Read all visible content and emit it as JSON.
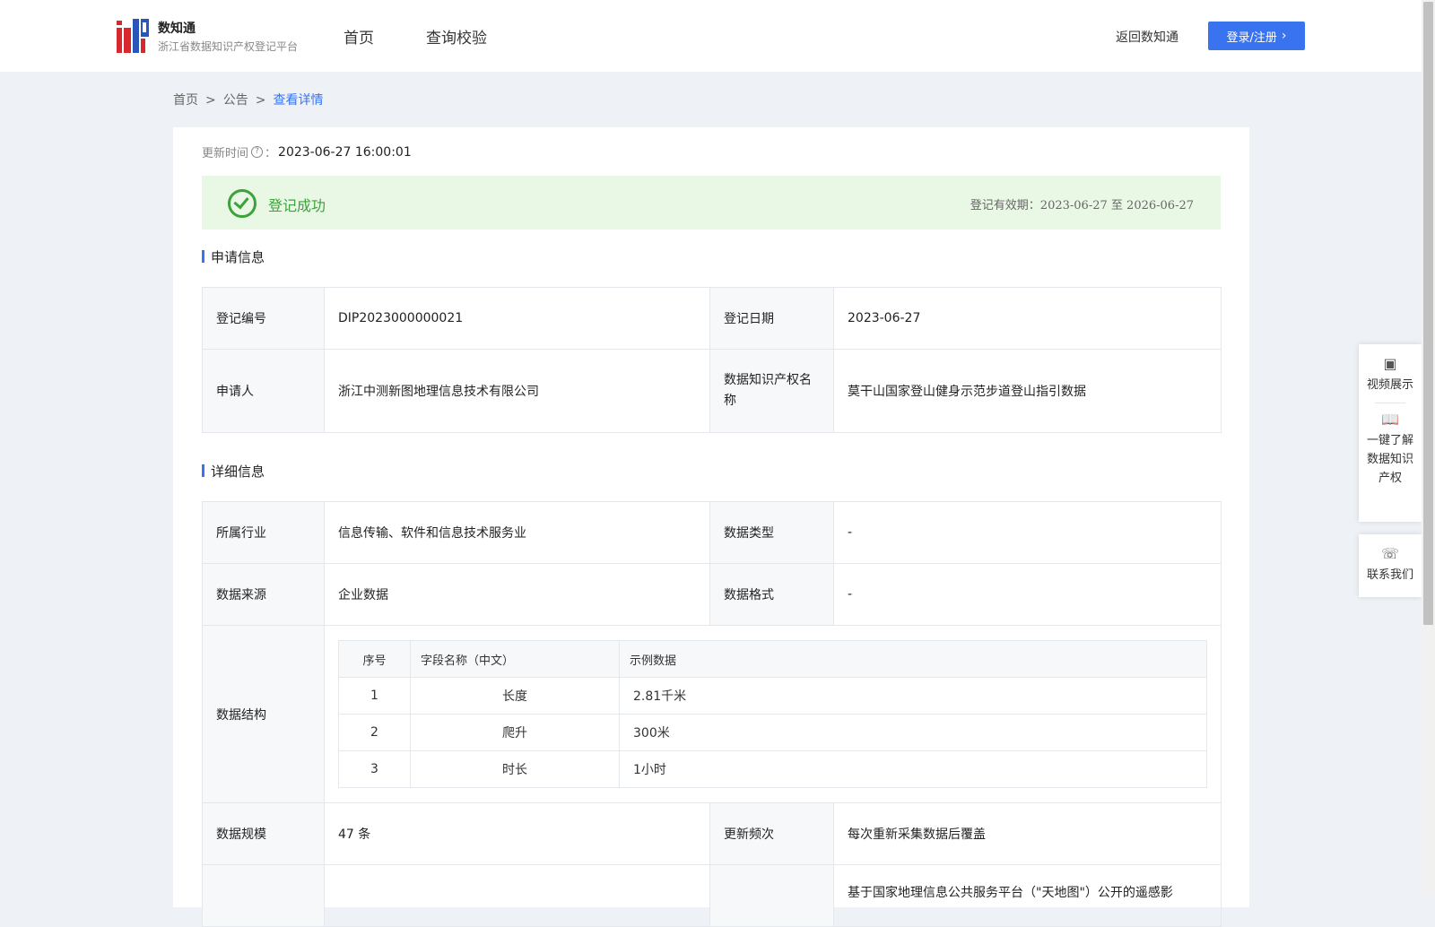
{
  "header": {
    "logo_title": "数知通",
    "logo_subtitle": "浙江省数据知识产权登记平台",
    "nav": [
      "首页",
      "查询校验"
    ],
    "back_link": "返回数知通",
    "login_button": "登录/注册"
  },
  "breadcrumb": [
    "首页",
    "公告",
    "查看详情"
  ],
  "update": {
    "label": "更新时间",
    "value": "2023-06-27 16:00:01"
  },
  "status": {
    "text": "登记成功",
    "validity_label": "登记有效期：",
    "validity_from": "2023-06-27",
    "validity_to_word": "至",
    "validity_to": "2026-06-27"
  },
  "apply_section": {
    "title": "申请信息",
    "reg_no_label": "登记编号",
    "reg_no_value": "DIP2023000000021",
    "reg_date_label": "登记日期",
    "reg_date_value": "2023-06-27",
    "applicant_label": "申请人",
    "applicant_value": "浙江中测新图地理信息技术有限公司",
    "ip_name_label": "数据知识产权名称",
    "ip_name_value": "莫干山国家登山健身示范步道登山指引数据"
  },
  "detail_section": {
    "title": "详细信息",
    "industry_label": "所属行业",
    "industry_value": "信息传输、软件和信息技术服务业",
    "data_type_label": "数据类型",
    "data_type_value": "-",
    "source_label": "数据来源",
    "source_value": "企业数据",
    "format_label": "数据格式",
    "format_value": "-",
    "structure_label": "数据结构",
    "structure_table": {
      "headers": [
        "序号",
        "字段名称（中文）",
        "示例数据"
      ],
      "rows": [
        [
          "1",
          "长度",
          "2.81千米"
        ],
        [
          "2",
          "爬升",
          "300米"
        ],
        [
          "3",
          "时长",
          "1小时"
        ]
      ]
    },
    "scale_label": "数据规模",
    "scale_value": "47 条",
    "frequency_label": "更新频次",
    "frequency_value": "每次重新采集数据后覆盖",
    "truncated_text": "基于国家地理信息公共服务平台（\"天地图\"）公开的遥感影"
  },
  "float_panel": {
    "video": "视频展示",
    "learn": "一键了解数据知识产权",
    "contact": "联系我们"
  },
  "colors": {
    "primary": "#3a73f0",
    "success": "#3ca23a",
    "success_bg": "#e9f7e5"
  }
}
